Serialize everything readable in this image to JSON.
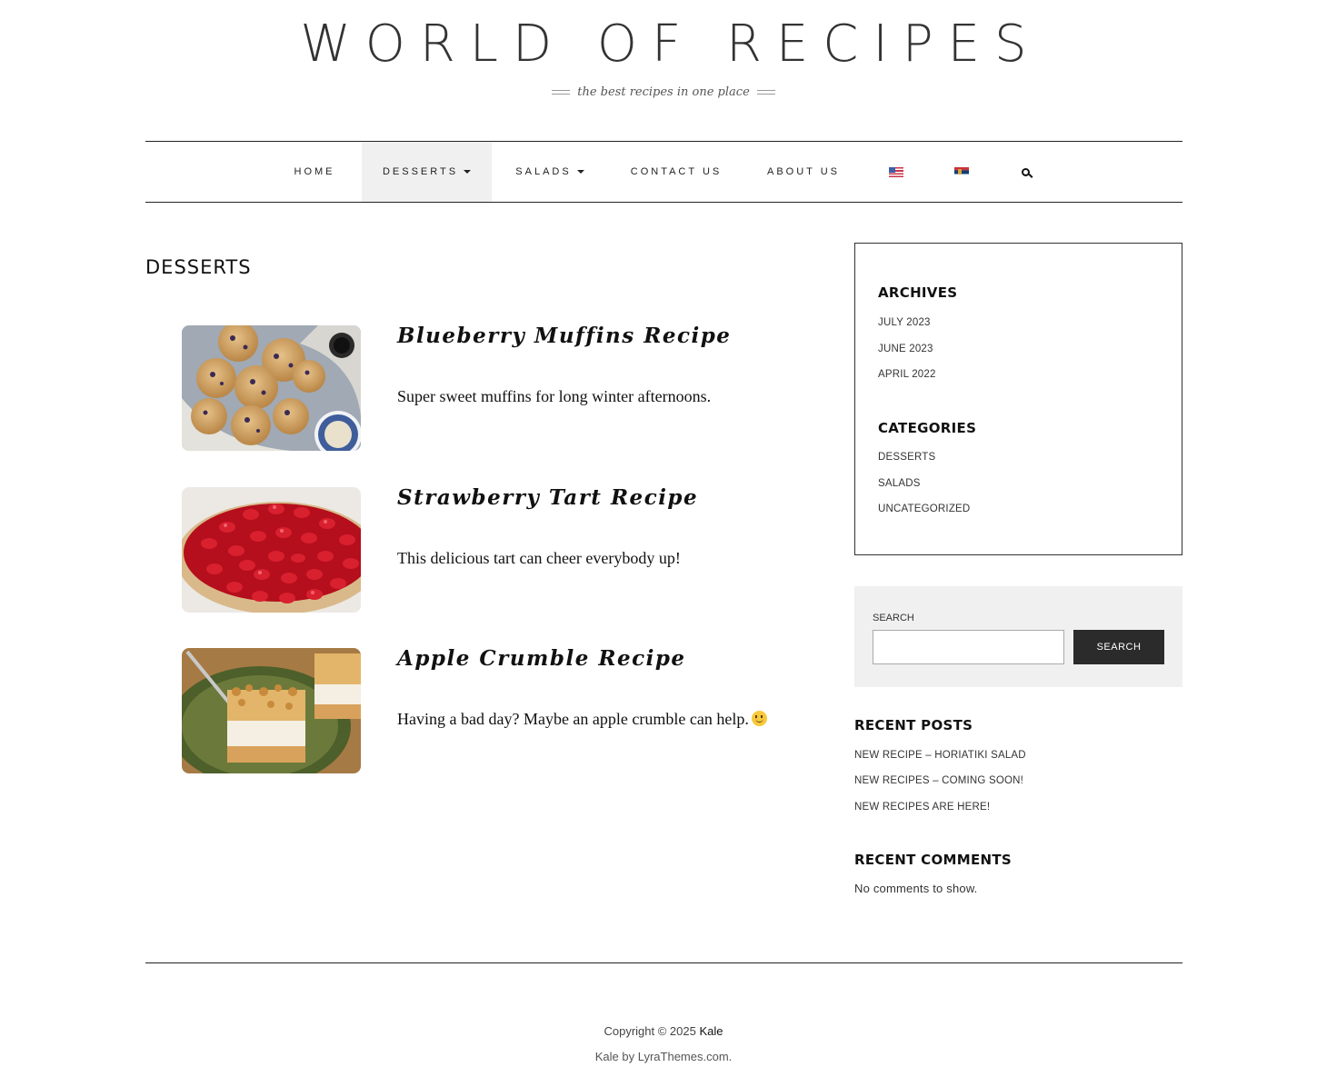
{
  "header": {
    "site_title": "WORLD OF RECIPES",
    "tagline": "the best recipes in one place"
  },
  "nav": {
    "items": [
      {
        "label": "HOME"
      },
      {
        "label": "DESSERTS"
      },
      {
        "label": "SALADS"
      },
      {
        "label": "CONTACT US"
      },
      {
        "label": "ABOUT US"
      }
    ],
    "flags": [
      "us-flag-icon",
      "serbia-flag-icon"
    ],
    "search_icon": "search-icon",
    "active_item": "DESSERTS",
    "active_bg": "#f0f0f0"
  },
  "main": {
    "page_title": "DESSERTS",
    "posts": [
      {
        "title": "Blueberry Muffins Recipe",
        "excerpt": "Super sweet muffins for long winter afternoons."
      },
      {
        "title": "Strawberry Tart Recipe",
        "excerpt": "This delicious tart can cheer everybody up!"
      },
      {
        "title": "Apple Crumble Recipe",
        "excerpt": "Having a bad day? Maybe an apple crumble can help."
      }
    ]
  },
  "sidebar": {
    "archives": {
      "title": "ARCHIVES",
      "items": [
        "JULY 2023",
        "JUNE 2023",
        "APRIL 2022"
      ]
    },
    "categories": {
      "title": "CATEGORIES",
      "items": [
        "DESSERTS",
        "SALADS",
        "UNCATEGORIZED"
      ]
    },
    "search": {
      "label": "SEARCH",
      "input_value": "",
      "button_label": "SEARCH"
    },
    "recent_posts": {
      "title": "RECENT POSTS",
      "items": [
        "NEW RECIPE – HORIATIKI SALAD",
        "NEW RECIPES – COMING SOON!",
        "NEW RECIPES ARE HERE!"
      ]
    },
    "recent_comments": {
      "title": "RECENT COMMENTS",
      "empty_text": "No comments to show."
    }
  },
  "footer": {
    "copyright_prefix": "Copyright © 2025",
    "brand": "Kale",
    "credit_prefix": "Kale by",
    "credit_link": "LyraThemes.com",
    "credit_suffix": "."
  }
}
